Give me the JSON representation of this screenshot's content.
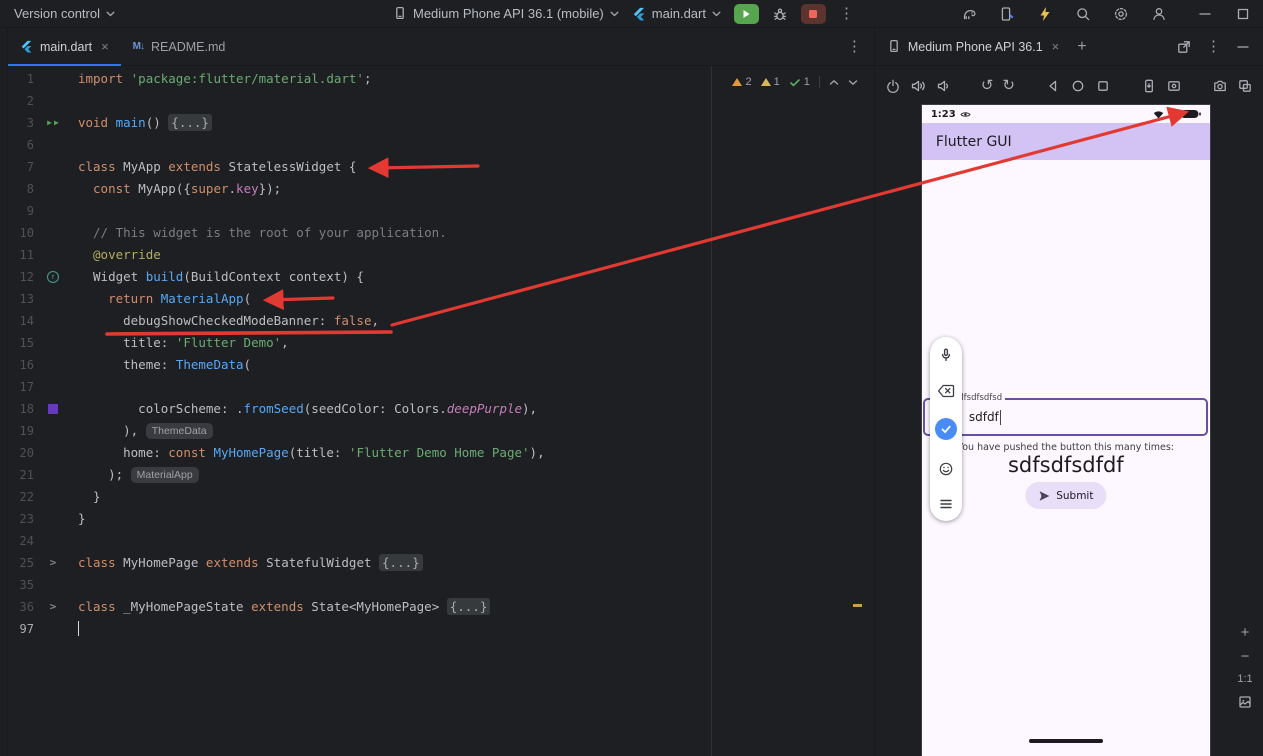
{
  "colors": {
    "accent": "#3574f0",
    "rungreen": "#57a64f",
    "red": "#e23a33",
    "kw": "#cf8e6d",
    "str": "#6aab73",
    "cmt": "#7a7e85",
    "fn": "#56a8f5",
    "mem": "#c77dbb",
    "meta": "#b3ae60",
    "swatch": "#673ab7",
    "surface": "#fdf7ff",
    "appbar": "#d2c3f4",
    "purple": "#6750a4",
    "submitbg": "#e8def8",
    "checkblue": "#4a8cf7"
  },
  "titlebar": {
    "project_menu": "Version control",
    "device": "Medium Phone API 36.1 (mobile)",
    "run_config": "main.dart"
  },
  "editor": {
    "tabs": [
      {
        "label": "main.dart"
      },
      {
        "label": "README.md"
      }
    ],
    "inspections": {
      "warnings": "2",
      "weak_warnings": "1",
      "ok": "1"
    },
    "lines": [
      {
        "num": "1",
        "tokens": [
          {
            "t": "import ",
            "c": "kw"
          },
          {
            "t": "'package:flutter/material.dart'",
            "c": "str"
          },
          {
            "t": ";",
            "c": "pl"
          }
        ]
      },
      {
        "num": "2",
        "tokens": []
      },
      {
        "num": "3",
        "gutter": "run",
        "tokens": [
          {
            "t": "void ",
            "c": "kw"
          },
          {
            "t": "main",
            "c": "fn"
          },
          {
            "t": "() ",
            "c": "pl"
          },
          {
            "t": "{...}",
            "c": "fold"
          }
        ]
      },
      {
        "num": "6",
        "tokens": []
      },
      {
        "num": "7",
        "tokens": [
          {
            "t": "class ",
            "c": "kw"
          },
          {
            "t": "MyApp ",
            "c": "pl"
          },
          {
            "t": "extends ",
            "c": "kw"
          },
          {
            "t": "StatelessWidget {",
            "c": "pl"
          }
        ]
      },
      {
        "num": "8",
        "tokens": [
          {
            "t": "  ",
            "c": "pl"
          },
          {
            "t": "const ",
            "c": "kw"
          },
          {
            "t": "MyApp({",
            "c": "pl"
          },
          {
            "t": "super",
            "c": "kw"
          },
          {
            "t": ".",
            "c": "pl"
          },
          {
            "t": "key",
            "c": "mem"
          },
          {
            "t": "});",
            "c": "pl"
          }
        ]
      },
      {
        "num": "9",
        "tokens": []
      },
      {
        "num": "10",
        "tokens": [
          {
            "t": "  // This widget is the root of your application.",
            "c": "cmt"
          }
        ]
      },
      {
        "num": "11",
        "tokens": [
          {
            "t": "  ",
            "c": "pl"
          },
          {
            "t": "@override",
            "c": "meta"
          }
        ]
      },
      {
        "num": "12",
        "gutter": "override",
        "tokens": [
          {
            "t": "  Widget ",
            "c": "pl"
          },
          {
            "t": "build",
            "c": "fn"
          },
          {
            "t": "(BuildContext context) {",
            "c": "pl"
          }
        ]
      },
      {
        "num": "13",
        "tokens": [
          {
            "t": "    ",
            "c": "pl"
          },
          {
            "t": "return ",
            "c": "kw"
          },
          {
            "t": "MaterialApp",
            "c": "fn"
          },
          {
            "t": "(",
            "c": "pl"
          }
        ]
      },
      {
        "num": "14",
        "tokens": [
          {
            "t": "      debugShowCheckedModeBanner: ",
            "c": "pl"
          },
          {
            "t": "false",
            "c": "kw"
          },
          {
            "t": ",",
            "c": "pl"
          }
        ]
      },
      {
        "num": "15",
        "tokens": [
          {
            "t": "      title: ",
            "c": "pl"
          },
          {
            "t": "'Flutter Demo'",
            "c": "str"
          },
          {
            "t": ",",
            "c": "pl"
          }
        ]
      },
      {
        "num": "16",
        "tokens": [
          {
            "t": "      theme: ",
            "c": "pl"
          },
          {
            "t": "ThemeData",
            "c": "fn"
          },
          {
            "t": "(",
            "c": "pl"
          }
        ]
      },
      {
        "num": "17",
        "tokens": []
      },
      {
        "num": "18",
        "gutter": "color",
        "tokens": [
          {
            "t": "        colorScheme: .",
            "c": "pl"
          },
          {
            "t": "fromSeed",
            "c": "fn"
          },
          {
            "t": "(seedColor: Colors.",
            "c": "pl"
          },
          {
            "t": "deepPurple",
            "c": "memi"
          },
          {
            "t": "),",
            "c": "pl"
          }
        ]
      },
      {
        "num": "19",
        "tokens": [
          {
            "t": "      ), ",
            "c": "pl"
          },
          {
            "t": "ThemeData",
            "c": "inlay"
          }
        ]
      },
      {
        "num": "20",
        "tokens": [
          {
            "t": "      home: ",
            "c": "pl"
          },
          {
            "t": "const ",
            "c": "kw"
          },
          {
            "t": "MyHomePage",
            "c": "fn"
          },
          {
            "t": "(title: ",
            "c": "pl"
          },
          {
            "t": "'Flutter Demo Home Page'",
            "c": "str"
          },
          {
            "t": "),",
            "c": "pl"
          }
        ]
      },
      {
        "num": "21",
        "tokens": [
          {
            "t": "    ); ",
            "c": "pl"
          },
          {
            "t": "MaterialApp",
            "c": "inlay"
          }
        ]
      },
      {
        "num": "22",
        "tokens": [
          {
            "t": "  }",
            "c": "pl"
          }
        ]
      },
      {
        "num": "23",
        "tokens": [
          {
            "t": "}",
            "c": "pl"
          }
        ]
      },
      {
        "num": "24",
        "tokens": []
      },
      {
        "num": "25",
        "gutter": "fold",
        "tokens": [
          {
            "t": "class ",
            "c": "kw"
          },
          {
            "t": "MyHomePage ",
            "c": "pl"
          },
          {
            "t": "extends ",
            "c": "kw"
          },
          {
            "t": "StatefulWidget ",
            "c": "pl"
          },
          {
            "t": "{...}",
            "c": "fold"
          }
        ]
      },
      {
        "num": "35",
        "tokens": []
      },
      {
        "num": "36",
        "gutter": "fold",
        "tokens": [
          {
            "t": "class ",
            "c": "kw"
          },
          {
            "t": "_MyHomePageState ",
            "c": "pl"
          },
          {
            "t": "extends ",
            "c": "kw"
          },
          {
            "t": "State<MyHomePage> ",
            "c": "pl"
          },
          {
            "t": "{...}",
            "c": "fold"
          }
        ]
      },
      {
        "num": "97",
        "caret": true,
        "tokens": []
      }
    ]
  },
  "device_panel": {
    "tab_title": "Medium Phone API 36.1",
    "zoom_label": "1:1"
  },
  "emulator": {
    "status_time": "1:23",
    "app_title": "Flutter GUI",
    "field_label": "sdfsdfsdfsd",
    "field_value": "sdfdf",
    "caption": "You have pushed the button this many times:",
    "counter_text": "sdfsdfsdfdf",
    "submit_label": "Submit"
  },
  "icons": {
    "titlebar": [
      "chevron-down-icon",
      "phone-icon",
      "flutter-icon",
      "run-icon",
      "debug-icon",
      "stop-icon",
      "more-vertical-icon",
      "gradle-icon",
      "device-manager-icon",
      "lightning-icon",
      "search-icon",
      "settings-icon",
      "profile-icon",
      "minimize-icon",
      "maximize-icon"
    ],
    "device_toolbar": [
      "power-icon",
      "volume-up-icon",
      "volume-down-icon",
      "rotate-left-icon",
      "rotate-right-icon",
      "back-icon",
      "home-icon",
      "recents-icon",
      "screenshot-icon",
      "record-icon",
      "camera-icon",
      "display-mode-icon"
    ],
    "ime_toolbar": [
      "microphone-icon",
      "backspace-icon",
      "check-icon",
      "emoji-icon",
      "menu-icon"
    ],
    "status_bar": [
      "eye-icon",
      "wifi-icon",
      "signal-icon",
      "battery-icon"
    ]
  }
}
